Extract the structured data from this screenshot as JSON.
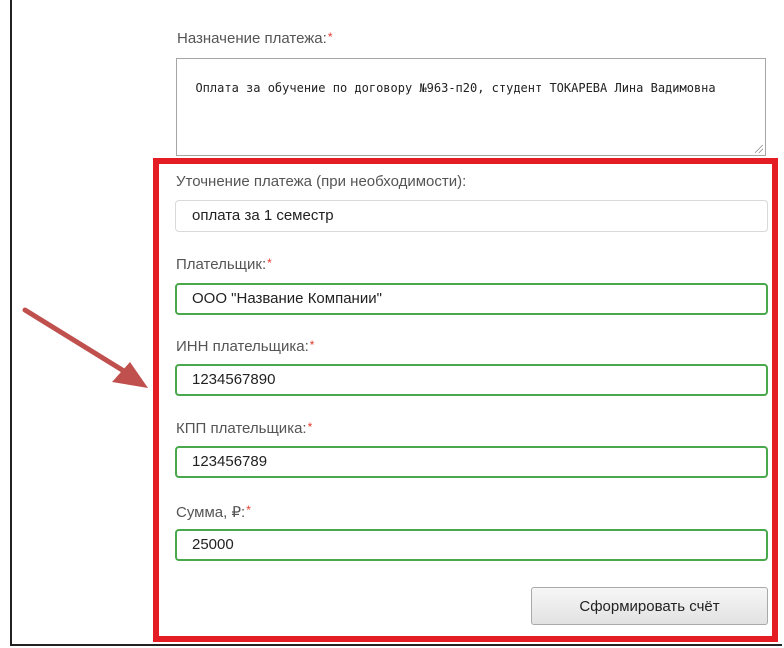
{
  "form": {
    "purpose": {
      "label": "Назначение платежа:",
      "required_mark": "*",
      "value": "Оплата за обучение по договору №963-п20, студент ТОКАРЕВА Лина Вадимовна"
    },
    "clarification": {
      "label": "Уточнение платежа (при необходимости):",
      "value": "оплата за 1 семестр"
    },
    "payer": {
      "label": "Плательщик:",
      "required_mark": "*",
      "value": "ООО \"Название Компании\""
    },
    "payer_inn": {
      "label": "ИНН плательщика:",
      "required_mark": "*",
      "value": "1234567890"
    },
    "payer_kpp": {
      "label": "КПП плательщика:",
      "required_mark": "*",
      "value": "123456789"
    },
    "amount": {
      "label": "Сумма, ₽:",
      "required_mark": "*",
      "value": "25000"
    },
    "submit_label": "Сформировать счёт"
  },
  "colors": {
    "highlight_border": "#e41c24",
    "arrow": "#c0504d",
    "valid_border": "#49a84b",
    "required_mark": "#e8382d"
  }
}
